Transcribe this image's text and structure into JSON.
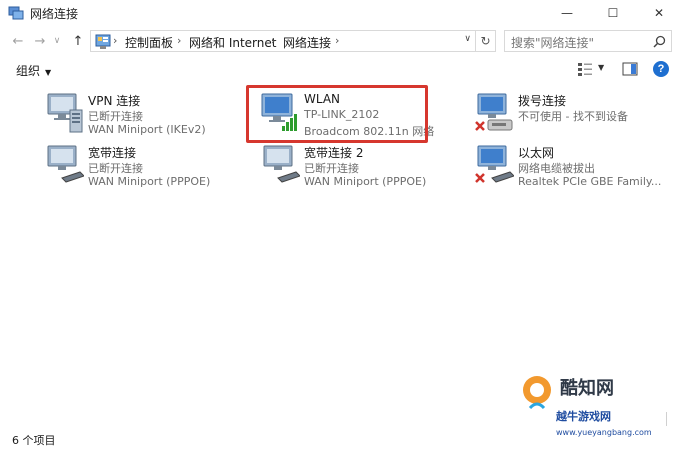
{
  "window": {
    "title": "网络连接",
    "min_glyph": "—",
    "max_glyph": "☐",
    "close_glyph": "✕"
  },
  "nav": {
    "back_glyph": "←",
    "forward_glyph": "→",
    "history_glyph": "∨",
    "up_glyph": "↑"
  },
  "address": {
    "crumbs": [
      "控制面板",
      "网络和 Internet",
      "网络连接"
    ],
    "separator": "›",
    "dropdown_glyph": "∨",
    "refresh_glyph": "↻"
  },
  "search": {
    "placeholder": "搜索\"网络连接\""
  },
  "toolbar": {
    "organize_label": "组织",
    "organize_arrow": "▼",
    "view_arrow": "▼",
    "help_label": "?"
  },
  "connections": [
    {
      "name": "VPN 连接",
      "status": "已断开连接",
      "device": "WAN Miniport (IKEv2)",
      "icon": "vpn-icon"
    },
    {
      "name": "WLAN",
      "status": "TP-LINK_2102",
      "device": "Broadcom 802.11n 网络",
      "icon": "wlan-icon",
      "selected": true
    },
    {
      "name": "拨号连接",
      "status": "不可使用 - 找不到设备",
      "device": "",
      "icon": "dialup-icon"
    },
    {
      "name": "宽带连接",
      "status": "已断开连接",
      "device": "WAN Miniport (PPPOE)",
      "icon": "broadband-icon"
    },
    {
      "name": "宽带连接 2",
      "status": "已断开连接",
      "device": "WAN Miniport (PPPOE)",
      "icon": "broadband-icon"
    },
    {
      "name": "以太网",
      "status": "网络电缆被拔出",
      "device": "Realtek PCIe GBE Family...",
      "icon": "ethernet-icon"
    }
  ],
  "statusbar": {
    "count": "6 个项目"
  },
  "watermark": {
    "line1": "酷知网",
    "line2": "越牛游戏网",
    "line3": "www.yueyangbang.com"
  },
  "colors": {
    "selection_border": "#d6372e",
    "help_blue": "#1e6fd0",
    "signal_green": "#2e9c2e",
    "error_red": "#d0342c"
  }
}
